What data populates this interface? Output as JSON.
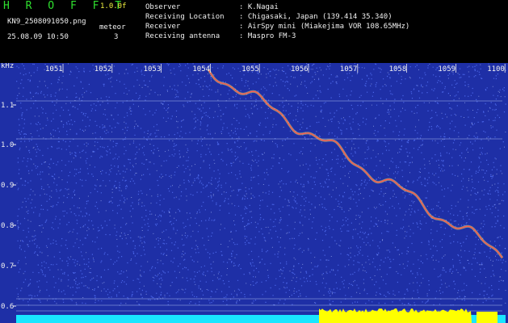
{
  "header": {
    "brand": "H R O F F T",
    "version": "1.0.0f",
    "filename": "KN9_2508091050.png",
    "datetime": "25.08.09 10:50",
    "meteor_label": "meteor",
    "meteor_count": "3",
    "info": [
      {
        "label": "Observer",
        "value": ": K.Nagai"
      },
      {
        "label": "Receiving Location",
        "value": ": Chigasaki, Japan (139.414 35.340)"
      },
      {
        "label": "Receiver",
        "value": ": AirSpy mini (Miakejima VOR 108.65MHz)"
      },
      {
        "label": "Receiving antenna",
        "value": ": Maspro FM-3"
      }
    ]
  },
  "spectrogram": {
    "y_unit": "kHz",
    "y_ticks": [
      "1.1",
      "1.0",
      "0.9",
      "0.8",
      "0.7",
      "0.6"
    ],
    "x_ticks": [
      "1051",
      "1052",
      "1053",
      "1054",
      "1055",
      "1056",
      "1057",
      "1058",
      "1059",
      "1100"
    ],
    "colors": {
      "background": "#1e2fa6",
      "noise": "#5a78ff",
      "trail": "#ff5050",
      "trail_light": "#e8f060",
      "baseline_low": "#19e6ff",
      "baseline_high": "#ffff00",
      "axis_text": "#f0f0f0"
    }
  }
}
